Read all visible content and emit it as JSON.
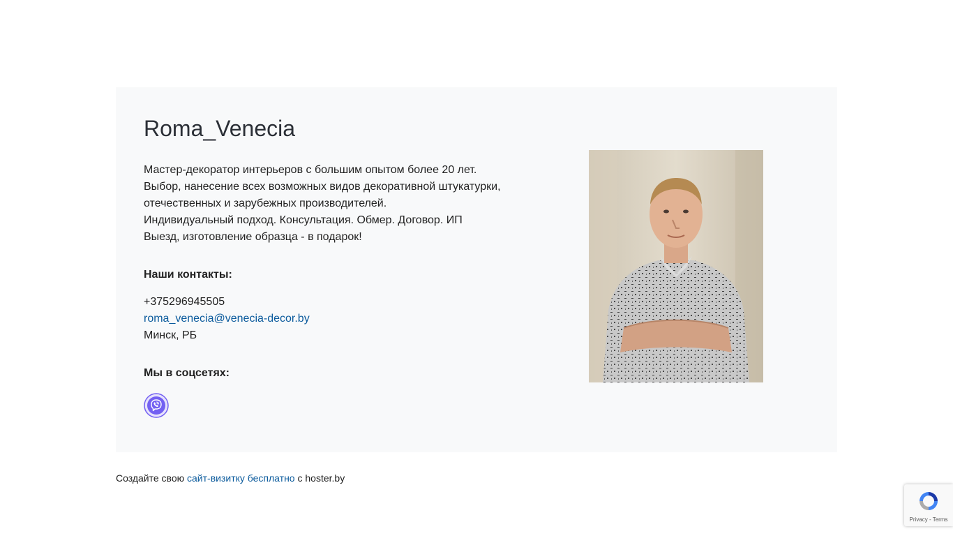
{
  "profile": {
    "title": "Roma_Venecia",
    "description_lines": [
      "Мастер-декоратор интерьеров с большим опытом более 20 лет.",
      "Выбор, нанесение всех возможных видов декоративной штукатурки,",
      "отечественных и зарубежных производителей.",
      "Индивидуальный подход. Консультация. Обмер. Договор. ИП",
      "Выезд, изготовление образца - в подарок!"
    ]
  },
  "contacts": {
    "heading": "Наши контакты:",
    "phone": "+375296945505",
    "email": "roma_venecia@venecia-decor.by",
    "location": "Минск, РБ"
  },
  "social": {
    "heading": "Мы в соцсетях:",
    "items": [
      {
        "icon": "viber-icon",
        "color": "#7360f2"
      }
    ]
  },
  "footer": {
    "prefix": "Создайте свою",
    "link_label": "сайт-визитку бесплатно",
    "suffix": "с hoster.by"
  },
  "recaptcha": {
    "links": "Privacy - Terms"
  },
  "colors": {
    "card_background": "#f8f9fa",
    "link": "#0a5a9c",
    "viber": "#7360f2"
  }
}
